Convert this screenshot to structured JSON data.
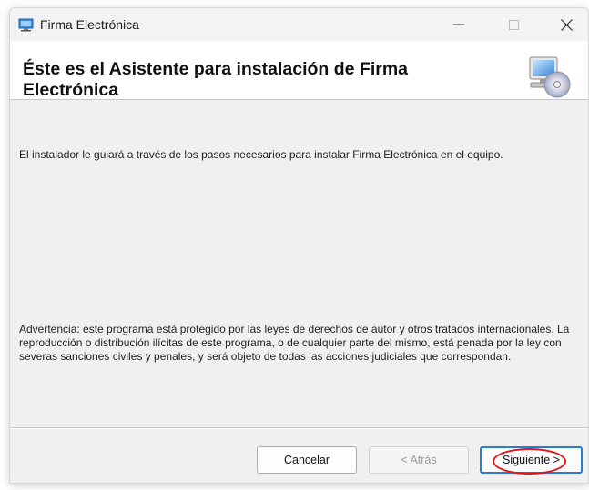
{
  "window": {
    "title": "Firma Electrónica",
    "controls": {
      "minimize_icon": "minimize-icon",
      "maximize_icon": "maximize-icon",
      "close_icon": "close-icon"
    }
  },
  "header": {
    "title": "Éste es el Asistente para instalación de Firma Electrónica",
    "art_icon": "computer-disc-icon"
  },
  "content": {
    "intro": "El instalador le guiará a través de los pasos necesarios para instalar Firma Electrónica en el equipo.",
    "warning": "Advertencia: este programa está protegido por las leyes de derechos de autor y otros tratados internacionales. La reproducción o distribución ilícitas de este programa, o de cualquier parte del mismo, está penada por la ley con severas sanciones civiles y penales, y será objeto de todas las acciones judiciales que correspondan."
  },
  "buttons": {
    "cancel": "Cancelar",
    "back": "< Atrás",
    "next": "Siguiente >"
  },
  "colors": {
    "focus_border": "#2b7ad6",
    "annotation_circle": "#e01515"
  }
}
